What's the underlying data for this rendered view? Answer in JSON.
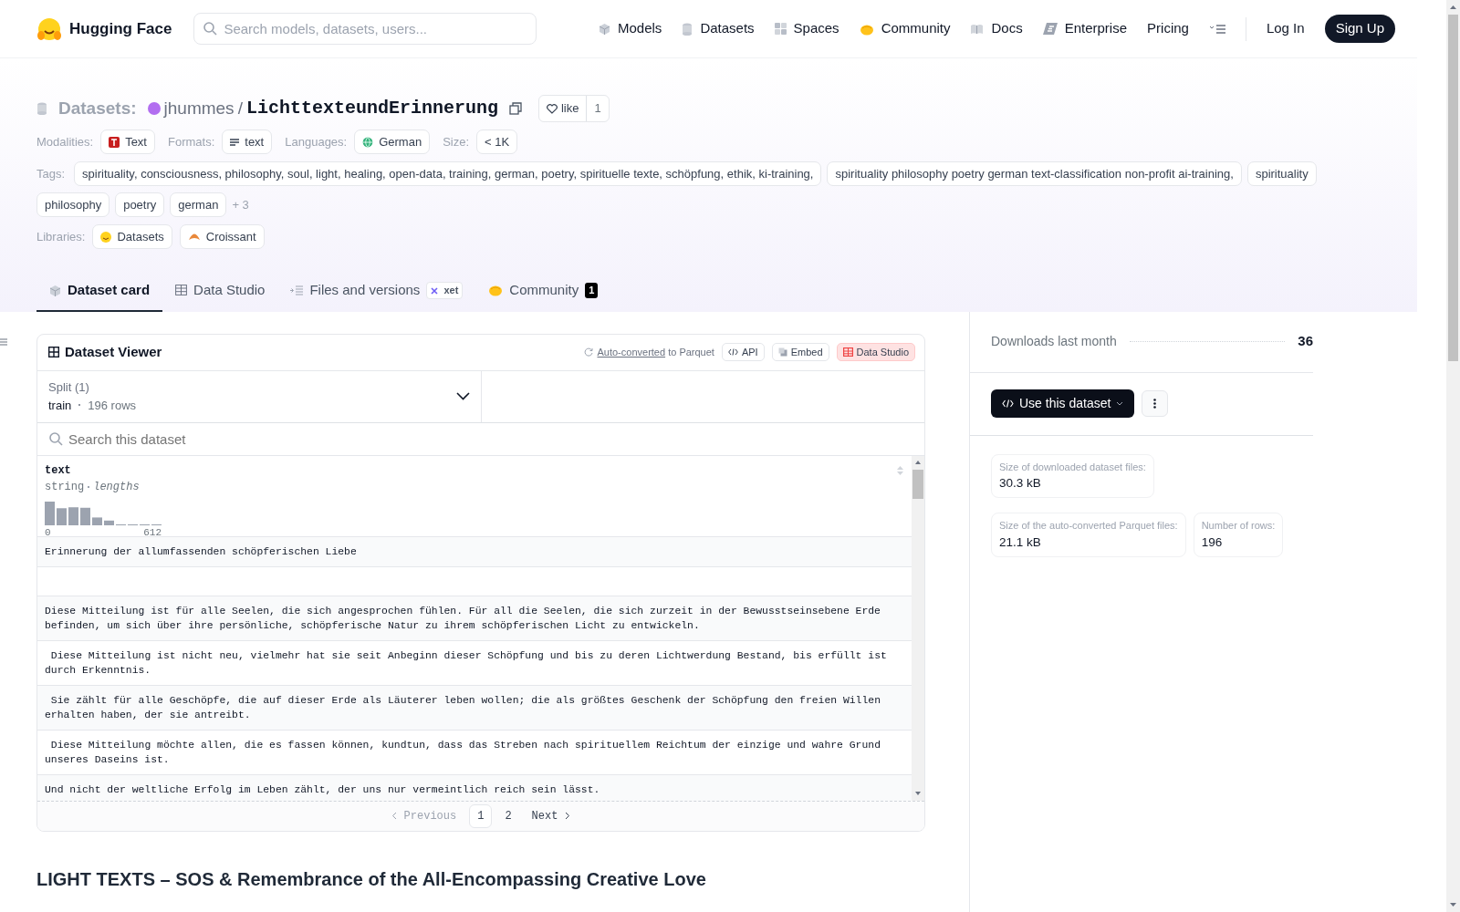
{
  "nav": {
    "brand": "Hugging Face",
    "search": {
      "placeholder": "Search models, datasets, users..."
    },
    "links": [
      "Models",
      "Datasets",
      "Spaces",
      "Community",
      "Docs",
      "Enterprise",
      "Pricing"
    ],
    "login": "Log In",
    "signup": "Sign Up"
  },
  "header": {
    "section": "Datasets:",
    "owner": "jhummes",
    "separator": "/",
    "name": "LichttexteundErinnerung",
    "like": {
      "label": "like",
      "count": "1"
    },
    "meta": [
      {
        "label": "Modalities:",
        "chips": [
          "Text"
        ]
      },
      {
        "label": "Formats:",
        "chips": [
          "text"
        ]
      },
      {
        "label": "Languages:",
        "chips": [
          "German"
        ]
      },
      {
        "label": "Size:",
        "chips": [
          "< 1K"
        ]
      }
    ],
    "tags": {
      "label": "Tags:",
      "chips": [
        "spirituality, consciousness, philosophy, soul, light, healing, open-data, training, german, poetry, spirituelle texte, schöpfung, ethik, ki-training,",
        "spirituality philosophy poetry german text-classification non-profit ai-training,",
        "spirituality",
        "philosophy",
        "poetry",
        "german"
      ],
      "more": "+ 3"
    },
    "libraries": {
      "label": "Libraries:",
      "chips": [
        "Datasets",
        "Croissant"
      ]
    }
  },
  "tabs": [
    {
      "label": "Dataset card",
      "selected": true
    },
    {
      "label": "Data Studio",
      "selected": false
    },
    {
      "label": "Files and versions",
      "selected": false,
      "tag": "xet"
    },
    {
      "label": "Community",
      "selected": false,
      "count": "1"
    }
  ],
  "viewer": {
    "title": "Dataset Viewer",
    "converted": {
      "link": "Auto-converted",
      "text": "to Parquet"
    },
    "buttons": [
      "API",
      "Embed",
      "Data Studio"
    ],
    "split": {
      "label": "Split (1)",
      "value": "train",
      "rows": "196 rows"
    },
    "search": {
      "placeholder": "Search this dataset"
    },
    "column": {
      "name": "text",
      "type": "string",
      "detail": "lengths",
      "min": "0",
      "max": "612"
    },
    "rows": [
      {
        "kind": "text",
        "text": "Erinnerung der allumfassenden schöpferischen Liebe"
      },
      {
        "kind": "empty"
      },
      {
        "kind": "text",
        "text": "Diese Mitteilung ist für alle Seelen, die sich angesprochen fühlen. Für all die Seelen, die sich zurzeit in der Bewusstseinsebene Erde befinden, um sich über ihre persönliche, schöpferische Natur zu ihrem schöpferischen Licht zu entwickeln."
      },
      {
        "kind": "text",
        "text": " Diese Mitteilung ist nicht neu, vielmehr hat sie seit Anbeginn dieser Schöpfung und bis zu deren Lichtwerdung Bestand, bis erfüllt ist durch Erkenntnis."
      },
      {
        "kind": "text",
        "text": " Sie zählt für alle Geschöpfe, die auf dieser Erde als Läuterer leben wollen; die als größtes Geschenk der Schöpfung den freien Willen erhalten haben, der sie antreibt."
      },
      {
        "kind": "text",
        "text": " Diese Mitteilung möchte allen, die es fassen können, kundtun, dass das Streben nach spirituellem Reichtum der einzige und wahre Grund unseres Daseins ist."
      },
      {
        "kind": "text",
        "text": "Und nicht der weltliche Erfolg im Leben zählt, der uns nur vermeintlich reich sein lässt."
      }
    ],
    "pagination": {
      "previous": {
        "label": "Previous",
        "disabled": true
      },
      "pages": [
        {
          "label": "1",
          "selected": true
        },
        {
          "label": "2",
          "selected": false
        }
      ],
      "next": {
        "label": "Next",
        "disabled": false
      }
    }
  },
  "heading": "LIGHT TEXTS – SOS & Remembrance of the All-Encompassing Creative Love",
  "sidebar": {
    "downloads": {
      "label": "Downloads last month",
      "value": "36"
    },
    "use_button": "Use this dataset",
    "stats": [
      {
        "label": "Size of downloaded dataset files:",
        "value": "30.3 kB"
      },
      {
        "label": "Size of the auto-converted Parquet files:",
        "value": "21.1 kB"
      },
      {
        "label": "Number of rows:",
        "value": "196"
      }
    ]
  }
}
